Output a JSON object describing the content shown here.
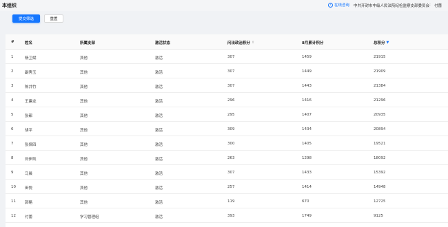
{
  "header": {
    "title": "本组织",
    "help_icon": "question-circle-icon",
    "help_label": "在线咨询",
    "org_name": "中共开封市中级人民法院纪检监察支部委员会",
    "separator": ":",
    "user_name": "付蕾"
  },
  "filters": {
    "submit_label": "提交筛选",
    "reset_label": "重置"
  },
  "table": {
    "columns": [
      "#",
      "姓名",
      "所属支部",
      "激活状态",
      "问法政治积分",
      "8月累计积分",
      "总积分"
    ],
    "sort_icons": {
      "col4": "sort-icon",
      "col6": "sort-desc-icon"
    },
    "rows": [
      [
        "1",
        "杨卫斌",
        "其他",
        "激活",
        "307",
        "1459",
        "21915"
      ],
      [
        "2",
        "副秀玉",
        "其他",
        "激活",
        "307",
        "1449",
        "21909"
      ],
      [
        "3",
        "陈井竹",
        "其他",
        "激活",
        "307",
        "1443",
        "21384"
      ],
      [
        "4",
        "王建龙",
        "其他",
        "激活",
        "296",
        "1416",
        "21296"
      ],
      [
        "5",
        "张都",
        "其他",
        "激活",
        "295",
        "1407",
        "20935"
      ],
      [
        "6",
        "胡平",
        "其他",
        "激活",
        "309",
        "1434",
        "20894"
      ],
      [
        "7",
        "张保四",
        "其他",
        "激活",
        "300",
        "1405",
        "19521"
      ],
      [
        "8",
        "刘伊凯",
        "其他",
        "激活",
        "263",
        "1298",
        "18092"
      ],
      [
        "9",
        "马晨",
        "其他",
        "激活",
        "307",
        "1433",
        "15392"
      ],
      [
        "10",
        "田悦",
        "其他",
        "激活",
        "257",
        "1414",
        "14948"
      ],
      [
        "11",
        "郭略",
        "其他",
        "激活",
        "119",
        "670",
        "12725"
      ],
      [
        "12",
        "付蕾",
        "学习管理组",
        "激活",
        "393",
        "1749",
        "9125"
      ]
    ]
  },
  "colors": {
    "primary": "#1677ff",
    "background": "#f0f2f5"
  }
}
